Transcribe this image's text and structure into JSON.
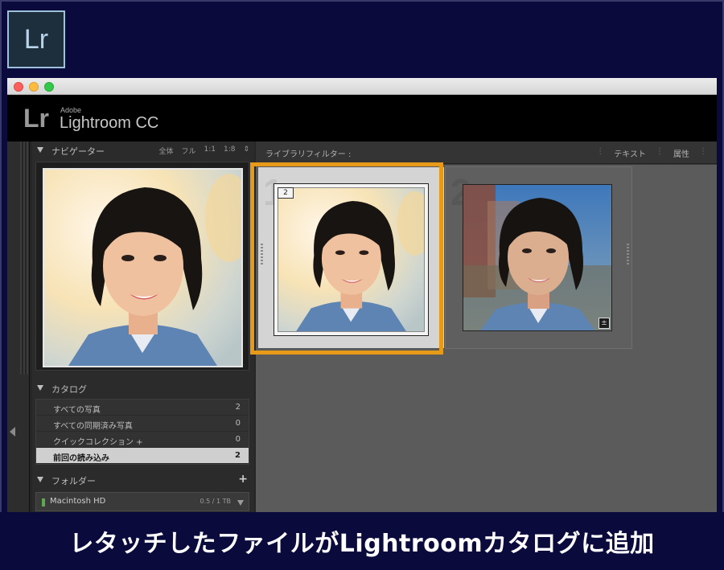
{
  "badge": {
    "logo_text": "Lr"
  },
  "app": {
    "logo_text": "Lr",
    "vendor": "Adobe",
    "product": "Lightroom CC"
  },
  "navigator": {
    "title": "ナビゲーター",
    "options": [
      "全体",
      "フル",
      "1:1",
      "1:8"
    ],
    "updown": "⇕"
  },
  "catalog": {
    "title": "カタログ",
    "items": [
      {
        "label": "すべての写真",
        "count": "2"
      },
      {
        "label": "すべての同期済み写真",
        "count": "0"
      },
      {
        "label": "クイックコレクション +",
        "count": "0"
      },
      {
        "label": "前回の読み込み",
        "count": "2",
        "selected": true
      }
    ]
  },
  "folders": {
    "title": "フォルダー",
    "add": "+",
    "disk_name": "Macintosh HD",
    "disk_size": "0.5 / 1 TB"
  },
  "filter_bar": {
    "label": "ライブラリフィルター :",
    "options": [
      "テキスト",
      "属性"
    ]
  },
  "grid": {
    "cells": [
      {
        "number": "1",
        "stack_badge": "2",
        "selected": true
      },
      {
        "number": "2",
        "edit_badge": "±"
      }
    ]
  },
  "caption": "レタッチしたファイルがLightroomカタログに追加",
  "colors": {
    "background": "#0a0a3c",
    "highlight": "#e69a18",
    "app_black": "#000000"
  }
}
